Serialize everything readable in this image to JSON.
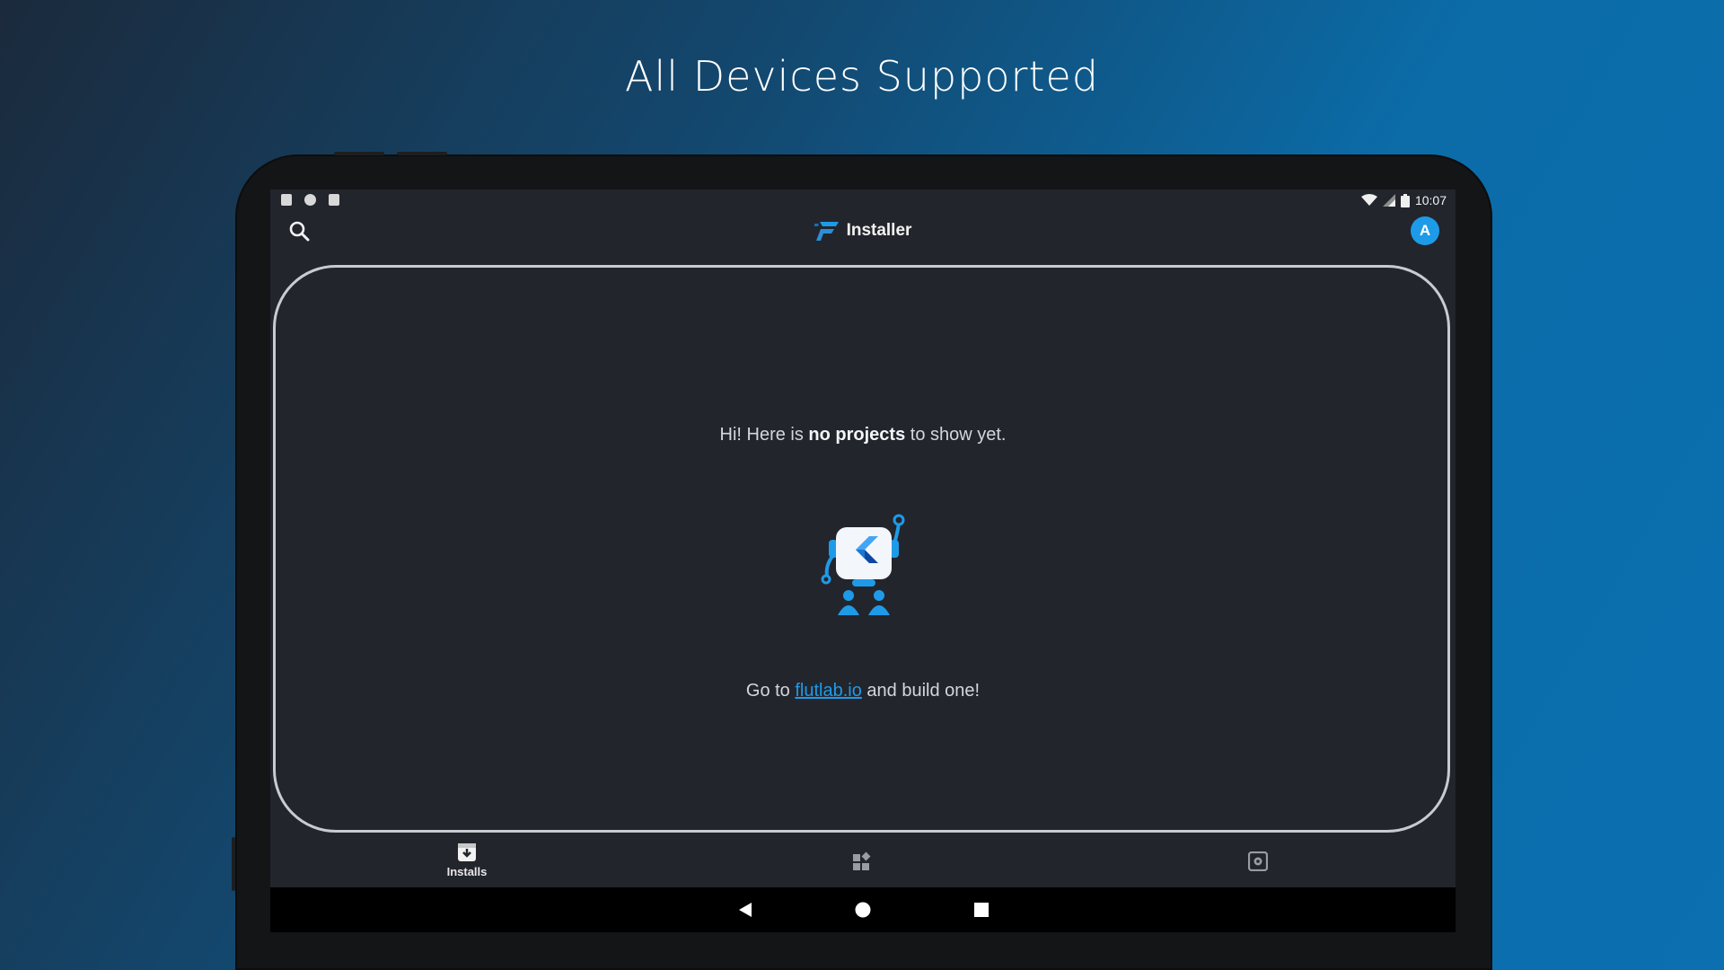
{
  "headline": "All Devices Supported",
  "status_bar": {
    "left_icons": [
      "notification-a-icon",
      "sync-icon",
      "sd-card-icon"
    ],
    "right_icons": [
      "wifi-icon",
      "cell-signal-icon",
      "battery-icon"
    ],
    "time": "10:07"
  },
  "app_bar": {
    "title": "Installer",
    "avatar_letter": "A",
    "left_icon": "search-icon",
    "logo_icon": "flutlab-logo-icon"
  },
  "empty_state": {
    "line1_pre": "Hi! Here is ",
    "line1_bold": "no projects",
    "line1_post": " to show yet.",
    "illustration": "flutter-robot-icon",
    "line2_pre": "Go to ",
    "line2_link": "flutlab.io",
    "line2_post": " and build one!"
  },
  "bottom_nav": {
    "items": [
      {
        "label": "Installs",
        "icon": "installs-icon",
        "active": true
      },
      {
        "label": "",
        "icon": "dashboard-icon",
        "active": false
      },
      {
        "label": "",
        "icon": "settings-icon",
        "active": false
      }
    ]
  },
  "system_nav": [
    "back-icon",
    "home-icon",
    "recents-icon"
  ],
  "colors": {
    "accent": "#1e9be8",
    "screen_bg": "#23252d",
    "frame": "#141517"
  }
}
